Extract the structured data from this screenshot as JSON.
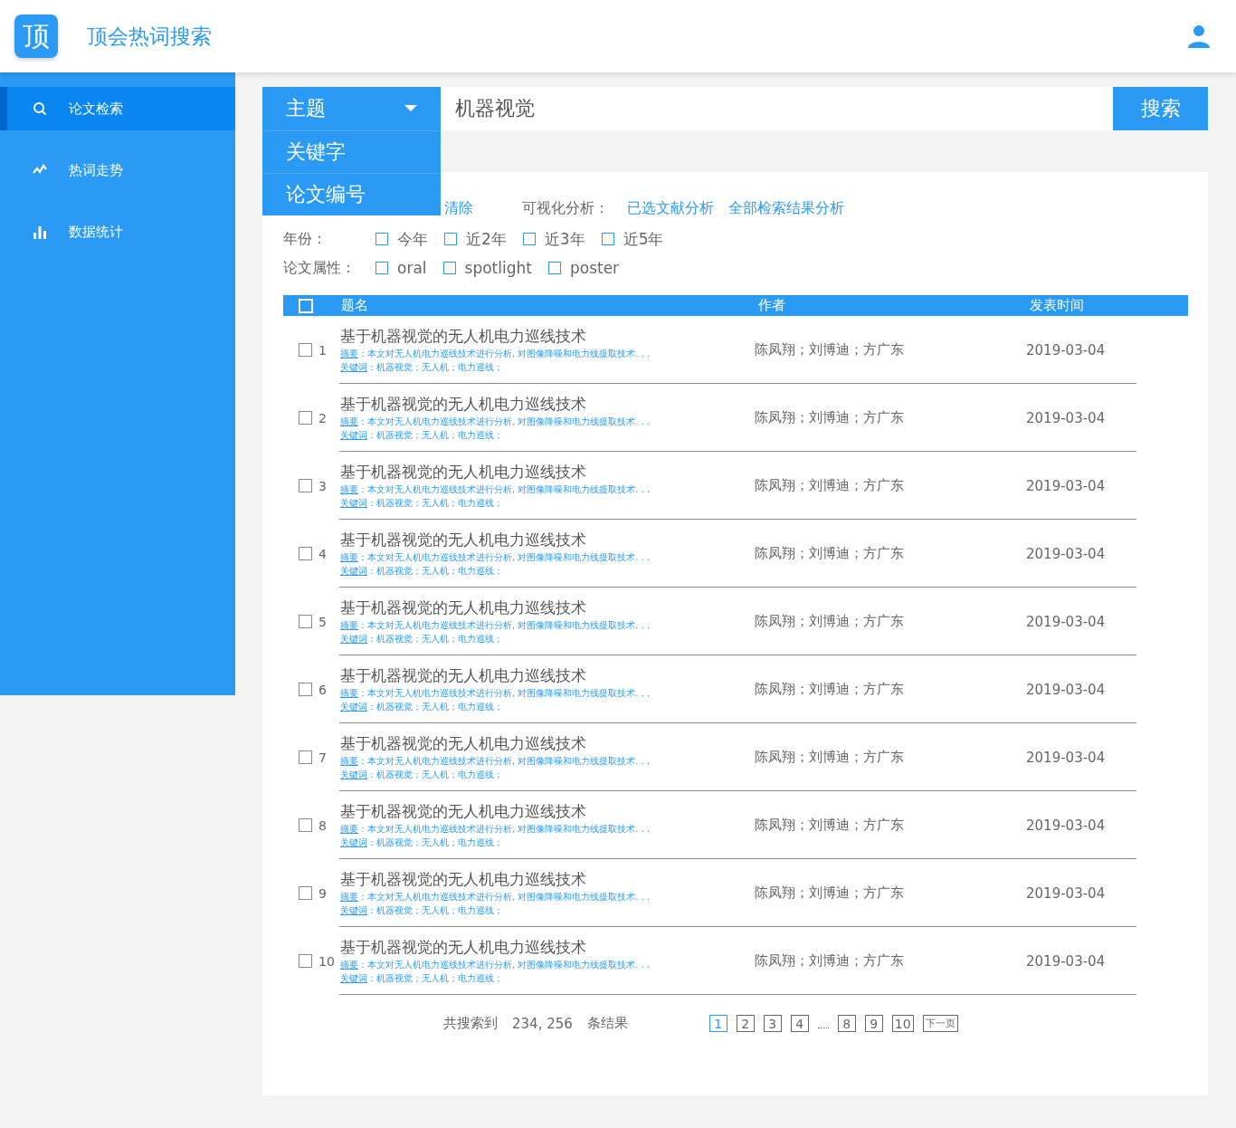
{
  "header": {
    "logo": "顶",
    "title": "顶会热词搜索"
  },
  "sidebar": {
    "items": [
      {
        "label": "论文检索",
        "selected": true
      },
      {
        "label": "热词走势",
        "selected": false
      },
      {
        "label": "数据统计",
        "selected": false
      }
    ]
  },
  "search": {
    "field": "主题",
    "options": [
      {
        "label": "关键字",
        "selected": false
      },
      {
        "label": "论文编号",
        "selected": false
      }
    ],
    "value": "机器视觉",
    "button": "搜索"
  },
  "filters": {
    "clear": "清除",
    "visual_label": "可视化分析：",
    "visual_links": [
      "已选文献分析",
      "全部检索结果分析"
    ],
    "groups": [
      {
        "label": "年份：",
        "options": [
          {
            "label": "今年",
            "checked": false
          },
          {
            "label": "近2年",
            "checked": false
          },
          {
            "label": "近3年",
            "checked": false
          },
          {
            "label": "近5年",
            "checked": false
          }
        ]
      },
      {
        "label": "论文属性：",
        "options": [
          {
            "label": "oral",
            "checked": false
          },
          {
            "label": "spotlight",
            "checked": false
          },
          {
            "label": "poster",
            "checked": false
          }
        ]
      }
    ]
  },
  "table": {
    "select_all": false,
    "columns": [
      "题名",
      "作者",
      "发表时间"
    ],
    "rows": [
      {
        "checked": false,
        "index": "1",
        "title": "基于机器视觉的无人机电力巡线技术",
        "abstract_label": "摘要",
        "abstract": "：本文对无人机电力巡线技术进行分析, 对图像降噪和电力线提取技术. . .",
        "keywords_label": "关键词",
        "keywords": "：机器视觉；无人机；电力巡线；",
        "authors": "陈凤翔；刘博迪；方广东",
        "date": "2019-03-04"
      },
      {
        "checked": false,
        "index": "2",
        "title": "基于机器视觉的无人机电力巡线技术",
        "abstract_label": "摘要",
        "abstract": "：本文对无人机电力巡线技术进行分析, 对图像降噪和电力线提取技术. . .",
        "keywords_label": "关键词",
        "keywords": "：机器视觉；无人机；电力巡线；",
        "authors": "陈凤翔；刘博迪；方广东",
        "date": "2019-03-04"
      },
      {
        "checked": false,
        "index": "3",
        "title": "基于机器视觉的无人机电力巡线技术",
        "abstract_label": "摘要",
        "abstract": "：本文对无人机电力巡线技术进行分析, 对图像降噪和电力线提取技术. . .",
        "keywords_label": "关键词",
        "keywords": "：机器视觉；无人机；电力巡线；",
        "authors": "陈凤翔；刘博迪；方广东",
        "date": "2019-03-04"
      },
      {
        "checked": false,
        "index": "4",
        "title": "基于机器视觉的无人机电力巡线技术",
        "abstract_label": "摘要",
        "abstract": "：本文对无人机电力巡线技术进行分析, 对图像降噪和电力线提取技术. . .",
        "keywords_label": "关键词",
        "keywords": "：机器视觉；无人机；电力巡线；",
        "authors": "陈凤翔；刘博迪；方广东",
        "date": "2019-03-04"
      },
      {
        "checked": false,
        "index": "5",
        "title": "基于机器视觉的无人机电力巡线技术",
        "abstract_label": "摘要",
        "abstract": "：本文对无人机电力巡线技术进行分析, 对图像降噪和电力线提取技术. . .",
        "keywords_label": "关键词",
        "keywords": "：机器视觉；无人机；电力巡线；",
        "authors": "陈凤翔；刘博迪；方广东",
        "date": "2019-03-04"
      },
      {
        "checked": false,
        "index": "6",
        "title": "基于机器视觉的无人机电力巡线技术",
        "abstract_label": "摘要",
        "abstract": "：本文对无人机电力巡线技术进行分析, 对图像降噪和电力线提取技术. . .",
        "keywords_label": "关键词",
        "keywords": "：机器视觉；无人机；电力巡线；",
        "authors": "陈凤翔；刘博迪；方广东",
        "date": "2019-03-04"
      },
      {
        "checked": false,
        "index": "7",
        "title": "基于机器视觉的无人机电力巡线技术",
        "abstract_label": "摘要",
        "abstract": "：本文对无人机电力巡线技术进行分析, 对图像降噪和电力线提取技术. . .",
        "keywords_label": "关键词",
        "keywords": "：机器视觉；无人机；电力巡线；",
        "authors": "陈凤翔；刘博迪；方广东",
        "date": "2019-03-04"
      },
      {
        "checked": false,
        "index": "8",
        "title": "基于机器视觉的无人机电力巡线技术",
        "abstract_label": "摘要",
        "abstract": "：本文对无人机电力巡线技术进行分析, 对图像降噪和电力线提取技术. . .",
        "keywords_label": "关键词",
        "keywords": "：机器视觉；无人机；电力巡线；",
        "authors": "陈凤翔；刘博迪；方广东",
        "date": "2019-03-04"
      },
      {
        "checked": false,
        "index": "9",
        "title": "基于机器视觉的无人机电力巡线技术",
        "abstract_label": "摘要",
        "abstract": "：本文对无人机电力巡线技术进行分析, 对图像降噪和电力线提取技术. . .",
        "keywords_label": "关键词",
        "keywords": "：机器视觉；无人机；电力巡线；",
        "authors": "陈凤翔；刘博迪；方广东",
        "date": "2019-03-04"
      },
      {
        "checked": false,
        "index": "10",
        "title": "基于机器视觉的无人机电力巡线技术",
        "abstract_label": "摘要",
        "abstract": "：本文对无人机电力巡线技术进行分析, 对图像降噪和电力线提取技术. . .",
        "keywords_label": "关键词",
        "keywords": "：机器视觉；无人机；电力巡线；",
        "authors": "陈凤翔；刘博迪；方广东",
        "date": "2019-03-04"
      }
    ]
  },
  "summary": {
    "prefix": "共搜索到",
    "count": "234, 256",
    "suffix": "条结果"
  },
  "pagination": {
    "pages": [
      {
        "label": "1",
        "selected": true
      },
      {
        "label": "2",
        "selected": false
      },
      {
        "label": "3",
        "selected": false
      },
      {
        "label": "4",
        "selected": false
      },
      {
        "kind": "gap"
      },
      {
        "label": "8",
        "selected": false
      },
      {
        "label": "9",
        "selected": false
      },
      {
        "label": "10",
        "selected": false
      }
    ],
    "next": "下一页"
  }
}
